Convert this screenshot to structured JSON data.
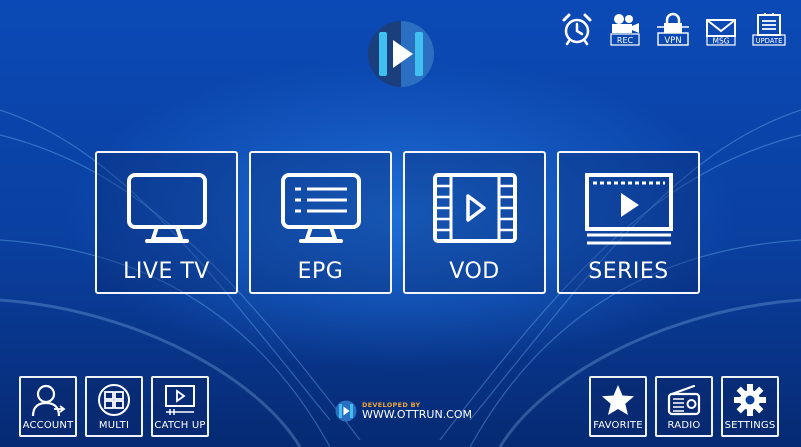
{
  "top_icons": [
    {
      "id": "alarm",
      "label": "",
      "icon": "alarm-clock-icon"
    },
    {
      "id": "rec",
      "label": "REC",
      "icon": "record-camera-icon"
    },
    {
      "id": "vpn",
      "label": "VPN",
      "icon": "vpn-shield-icon"
    },
    {
      "id": "msg",
      "label": "MSG",
      "icon": "message-envelope-icon"
    },
    {
      "id": "update",
      "label": "UPDATE",
      "icon": "update-icon"
    }
  ],
  "tiles": [
    {
      "id": "live_tv",
      "label": "LIVE TV",
      "icon": "tv-icon"
    },
    {
      "id": "epg",
      "label": "EPG",
      "icon": "epg-icon"
    },
    {
      "id": "vod",
      "label": "VOD",
      "icon": "film-play-icon"
    },
    {
      "id": "series",
      "label": "SERIES",
      "icon": "series-play-icon"
    }
  ],
  "bottom_left": [
    {
      "id": "account",
      "label": "ACCOUNT",
      "icon": "account-icon"
    },
    {
      "id": "multi",
      "label": "MULTI",
      "icon": "multi-screen-icon"
    },
    {
      "id": "catch_up",
      "label": "CATCH UP",
      "icon": "catch-up-icon"
    }
  ],
  "bottom_right": [
    {
      "id": "favorite",
      "label": "FAVORITE",
      "icon": "star-icon"
    },
    {
      "id": "radio",
      "label": "RADIO",
      "icon": "radio-icon"
    },
    {
      "id": "settings",
      "label": "SETTINGS",
      "icon": "gear-icon"
    }
  ],
  "developer": {
    "prefix": "DEVELOPED BY",
    "url": "WWW.OTTRUN.COM"
  },
  "colors": {
    "accent": "#3fc0ee",
    "background": "#0b4ab6",
    "orange": "#f3a63b"
  }
}
